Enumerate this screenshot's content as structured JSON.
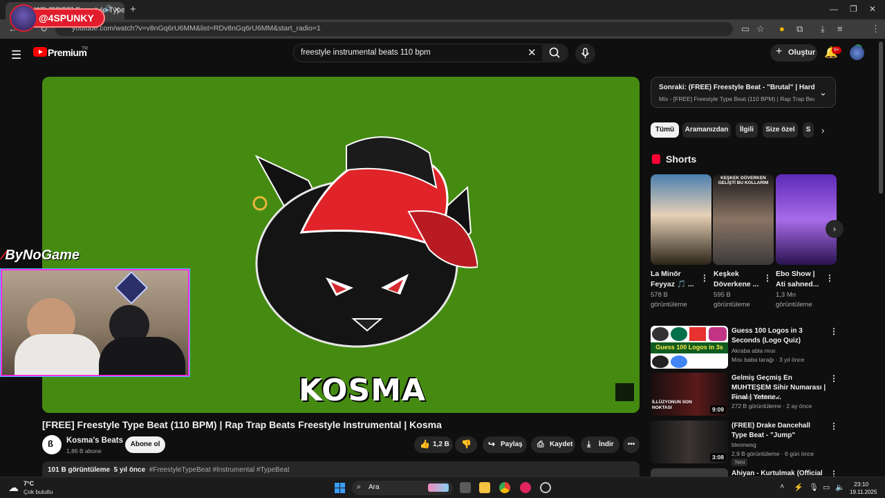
{
  "browser": {
    "tab_title": "(67) [FREE] Freestyle Type B...",
    "url": "youtube.com/watch?v=v8nGq6rU6MM&list=RDv8nGq6rU6MM&start_radio=1"
  },
  "overlay": {
    "streamer_handle": "@4SPUNKY",
    "sponsor": "ByNoGame"
  },
  "header": {
    "brand": "Premium",
    "region": "TR",
    "search_value": "freestyle instrumental beats 110 bpm",
    "create_label": "Oluştur",
    "notif_count": "9+"
  },
  "player": {
    "watermark": "KOSMA"
  },
  "video": {
    "title": "[FREE] Freestyle Type Beat (110 BPM) | Rap Trap Beats Freestyle Instrumental | Kosma",
    "channel_name": "Kosma's Beats",
    "subscribers": "1,86 B abone",
    "subscribe_label": "Abone ol",
    "likes": "1,2 B",
    "share_label": "Paylaş",
    "save_label": "Kaydet",
    "download_label": "İndir",
    "views": "101 B görüntüleme",
    "age": "5 yıl önce",
    "tags": "#FreestyleTypeBeat #Instrumental #TypeBeat"
  },
  "sidebar": {
    "next_title": "Sonraki: (FREE) Freestyle Beat - \"Brutal\" | Hard Type...",
    "next_sub": "Mix - [FREE] Freestyle Type Beat (110 BPM) | Rap Trap Beats ...",
    "chips": [
      "Tümü",
      "Aramanızdan",
      "İlgili",
      "Size özel",
      "S"
    ],
    "shorts_label": "Shorts",
    "shorts": [
      {
        "title1": "La Minör",
        "title2": "Feyyaz 🎵 ...",
        "views1": "578 B",
        "views2": "görüntüleme",
        "overlay": ""
      },
      {
        "title1": "Keşkek",
        "title2": "Döverkene ...",
        "views1": "595 B",
        "views2": "görüntüleme",
        "overlay": "KEŞKEK DÖVERKEN GELİŞTİ BU KOLLARIM"
      },
      {
        "title1": "Ebo Show |",
        "title2": "Ati sahned...",
        "views1": "1,3 Mn",
        "views2": "görüntüleme",
        "overlay": ""
      }
    ],
    "recs": [
      {
        "title": "Guess 100 Logos in 3 Seconds (Logo Quiz)",
        "channel": "Akraba abla mısı",
        "meta": "Mısı baba tarağı · 3 yıl önce",
        "duration": "",
        "thumb_text": "Guess 100 Logos in 3s"
      },
      {
        "title": "Gelmiş Geçmiş En MUHTEŞEM Sihir Numarası | Final | Yetene...",
        "channel": "Yetenek Sizsiniz",
        "meta": "272 B görüntüleme · 2 ay önce",
        "duration": "9:09",
        "thumb_text": "İLLÜZYONUN SON NOKTASI"
      },
      {
        "title": "(FREE) Drake Dancehall Type Beat - \"Jump\"",
        "channel": "bleonwsg",
        "meta": "2,9 B görüntüleme · 6 gün önce",
        "duration": "3:08",
        "thumb_text": "",
        "badge": "Yeni"
      },
      {
        "title": "Ahiyan - Kurtulmak (Official",
        "channel": "",
        "meta": "",
        "duration": "",
        "thumb_text": ""
      }
    ]
  },
  "taskbar": {
    "temperature": "7°C",
    "weather": "Çok bulutlu",
    "search_label": "Ara",
    "time": "23:10",
    "date": "19.11.2025"
  },
  "colors": {
    "player_bg": "#458b12",
    "accent": "#ff0000",
    "webcam_border": "#ff2de0"
  }
}
